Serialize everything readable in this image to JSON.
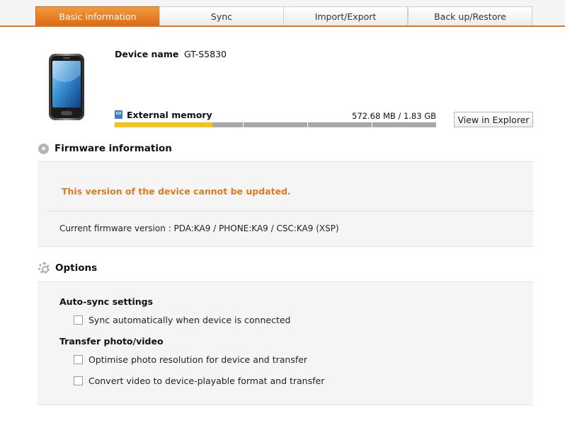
{
  "tabs": [
    {
      "label": "Basic information",
      "active": true
    },
    {
      "label": "Sync",
      "active": false
    },
    {
      "label": "Import/Export",
      "active": false
    },
    {
      "label": "Back up/Restore",
      "active": false
    }
  ],
  "device": {
    "name_label": "Device name",
    "name_separator": ":",
    "name_value": "GT-S5830"
  },
  "memory": {
    "label": "External memory",
    "usage": "572.68 MB / 1.83 GB",
    "used_fraction": 0.305,
    "explorer_button": "View in Explorer"
  },
  "firmware": {
    "title": "Firmware information",
    "warning": "This version of the device cannot be updated.",
    "current_version": "Current firmware version : PDA:KA9 / PHONE:KA9 / CSC:KA9 (XSP)"
  },
  "options": {
    "title": "Options",
    "autosync_heading": "Auto-sync settings",
    "autosync_option": "Sync automatically when device is connected",
    "transfer_heading": "Transfer photo/video",
    "transfer_options": [
      "Optimise photo resolution for device and transfer",
      "Convert video to device-playable format and transfer"
    ]
  },
  "colors": {
    "accent": "#e07a22",
    "memory_fill": "#f6c21c",
    "warning_text": "#e07a22"
  }
}
